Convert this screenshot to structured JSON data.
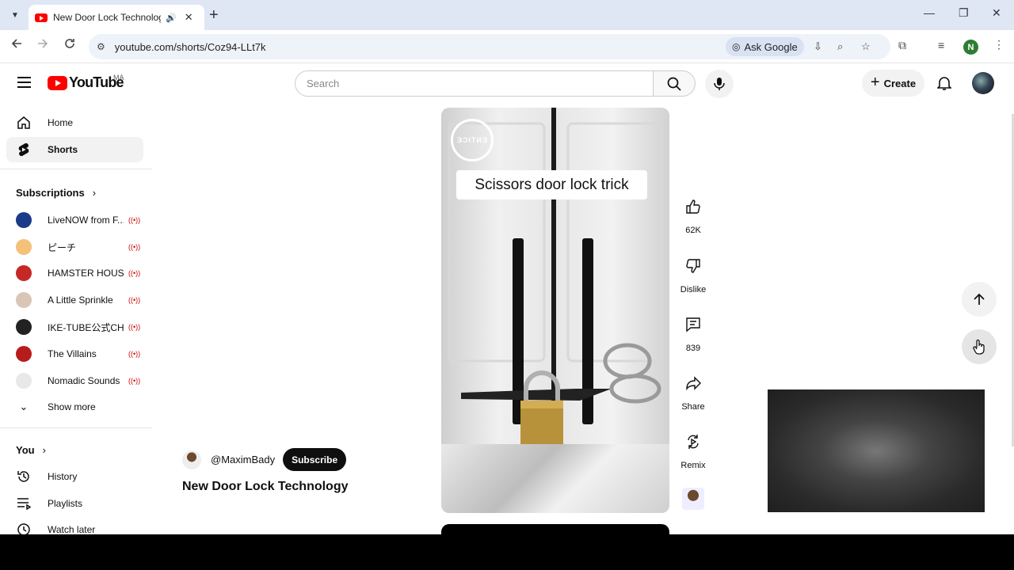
{
  "browser": {
    "tab_title": "New Door Lock Technology",
    "url": "youtube.com/shorts/Coz94-LLt7k",
    "ask_google": "Ask Google",
    "profile_initial": "N"
  },
  "masthead": {
    "logo_text": "YouTube",
    "country_code": "MA",
    "search_placeholder": "Search",
    "create_label": "Create"
  },
  "sidebar": {
    "home": "Home",
    "shorts": "Shorts",
    "subscriptions_heading": "Subscriptions",
    "subscriptions": [
      {
        "name": "LiveNOW from F...",
        "color": "#1a3a8a"
      },
      {
        "name": "ピーチ",
        "color": "#f4c07a"
      },
      {
        "name": "HAMSTER HOUS...",
        "color": "#c62828"
      },
      {
        "name": "A Little Sprinkle",
        "color": "#d9c6b5"
      },
      {
        "name": "IKE-TUBE公式CH",
        "color": "#222222"
      },
      {
        "name": "The Villains",
        "color": "#b71c1c"
      },
      {
        "name": "Nomadic Sounds",
        "color": "#e8e8e8"
      }
    ],
    "show_more": "Show more",
    "you_heading": "You",
    "history": "History",
    "playlists": "Playlists",
    "watch_later": "Watch later"
  },
  "short": {
    "caption": "Scissors door lock trick",
    "watermark": "ENTICE",
    "channel": "@MaximBady",
    "subscribe": "Subscribe",
    "title": "New Door Lock Technology",
    "likes": "62K",
    "dislike": "Dislike",
    "comments": "839",
    "share": "Share",
    "remix": "Remix"
  }
}
